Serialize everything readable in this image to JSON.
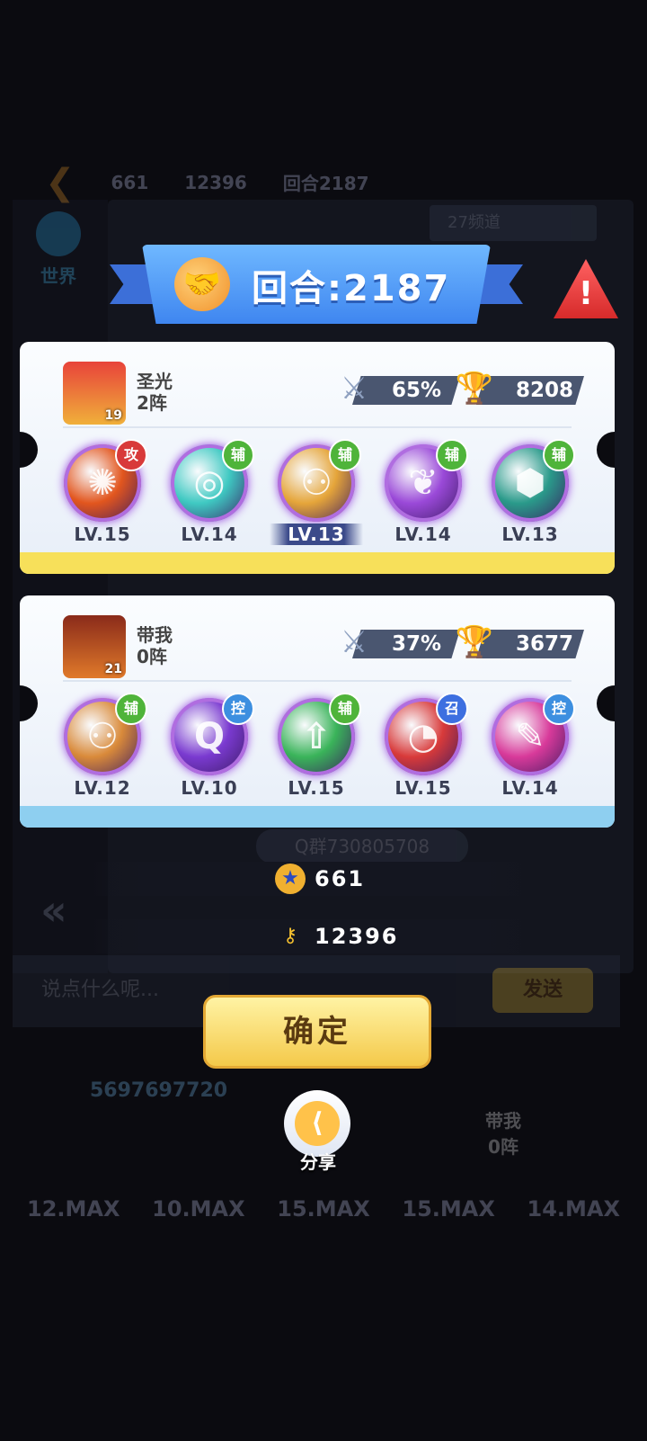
{
  "background": {
    "top_bar": {
      "count_a": "661",
      "count_b": "12396",
      "round_text": "回合2187"
    },
    "world_tab": "世界",
    "channel": "27频道",
    "qq_group": "Q群730805708",
    "chat_placeholder": "说点什么呢...",
    "send_label": "发送",
    "player_id": "5697697720",
    "sub_label": "带我\n0阵",
    "max_levels": [
      "12.MAX",
      "10.MAX",
      "15.MAX",
      "15.MAX",
      "14.MAX"
    ]
  },
  "header": {
    "title": "回合:2187",
    "alert_icon": "!"
  },
  "teams": [
    {
      "name": "圣光",
      "formation": "2阵",
      "avatar_level": "19",
      "win_rate": "65%",
      "trophies": "8208",
      "footer_color": "#f7e05a",
      "skills": [
        {
          "tag": "攻",
          "tag_color": "#d83a3a",
          "level": "LV.15",
          "orb_color": "#e2561e",
          "glyph": "✺",
          "highlight": false
        },
        {
          "tag": "辅",
          "tag_color": "#4fb43a",
          "level": "LV.14",
          "orb_color": "#3fc9c2",
          "glyph": "◎",
          "highlight": false
        },
        {
          "tag": "辅",
          "tag_color": "#4fb43a",
          "level": "LV.13",
          "orb_color": "#e5a53a",
          "glyph": "⚇",
          "highlight": true
        },
        {
          "tag": "辅",
          "tag_color": "#4fb43a",
          "level": "LV.14",
          "orb_color": "#9a49d8",
          "glyph": "❦",
          "highlight": false
        },
        {
          "tag": "辅",
          "tag_color": "#4fb43a",
          "level": "LV.13",
          "orb_color": "#2a9a8a",
          "glyph": "⬢",
          "highlight": false
        }
      ]
    },
    {
      "name": "带我",
      "formation": "0阵",
      "avatar_level": "21",
      "win_rate": "37%",
      "trophies": "3677",
      "footer_color": "#8ecff0",
      "skills": [
        {
          "tag": "辅",
          "tag_color": "#4fb43a",
          "level": "LV.12",
          "orb_color": "#d98a3a",
          "glyph": "⚇",
          "highlight": false
        },
        {
          "tag": "控",
          "tag_color": "#3d8fe0",
          "level": "LV.10",
          "orb_color": "#7a3ad0",
          "glyph": "Q",
          "highlight": false
        },
        {
          "tag": "辅",
          "tag_color": "#4fb43a",
          "level": "LV.15",
          "orb_color": "#3ab45a",
          "glyph": "⇧",
          "highlight": false
        },
        {
          "tag": "召",
          "tag_color": "#3d6fe0",
          "level": "LV.15",
          "orb_color": "#d83a3a",
          "glyph": "◔",
          "highlight": false
        },
        {
          "tag": "控",
          "tag_color": "#3d8fe0",
          "level": "LV.14",
          "orb_color": "#d83a9a",
          "glyph": "✎",
          "highlight": false
        }
      ]
    }
  ],
  "currencies": [
    {
      "icon": "star-coin-icon",
      "value": "661"
    },
    {
      "icon": "key-icon",
      "value": "12396"
    }
  ],
  "confirm_label": "确定",
  "share_label": "分享"
}
